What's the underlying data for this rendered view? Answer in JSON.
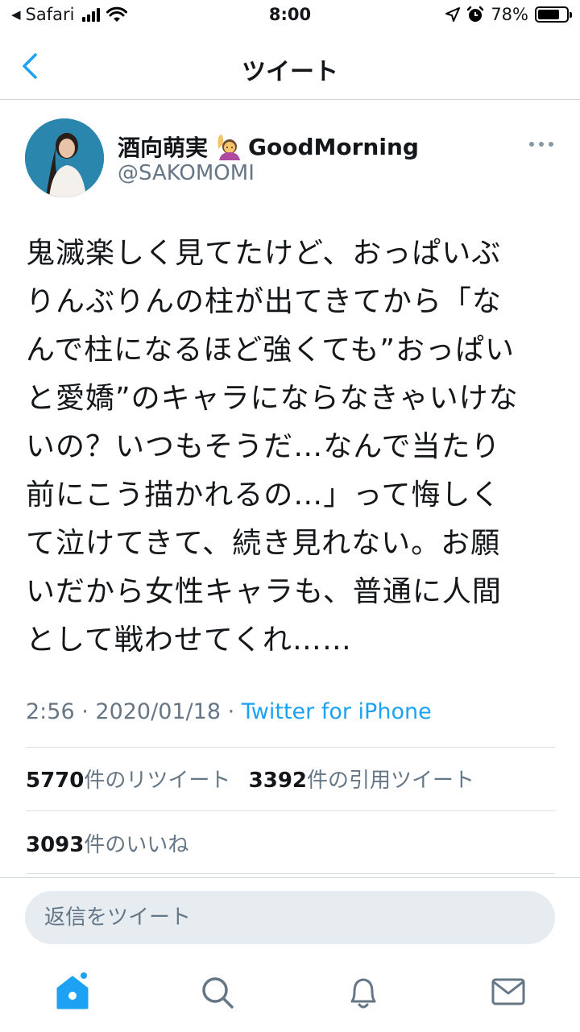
{
  "status_bar": {
    "carrier": "Safari",
    "time": "8:00",
    "battery": "78%",
    "battery_level": 0.78
  },
  "nav": {
    "title": "ツイート"
  },
  "author": {
    "name": "酒向萌実",
    "name_suffix": "GoodMorning",
    "handle": "@SAKOMOMI"
  },
  "tweet": {
    "lines": [
      "鬼滅楽しく見てたけど、おっぱいぶ",
      "りんぶりんの柱が出てきてから「な",
      "んで柱になるほど強くても”おっぱい",
      "と愛嬌”のキャラにならなきゃいけな",
      "いの？いつもそうだ…なんで当たり",
      "前にこう描かれるの…」って悔しく",
      "て泣けてきて、続き見れない。お願",
      "いだから女性キャラも、普通に人間",
      "として戦わせてくれ……"
    ],
    "time": "2:56",
    "date": "2020/01/18",
    "separator": " · ",
    "source": "Twitter for iPhone"
  },
  "stats": {
    "retweets_count": "5770",
    "retweets_label": "件のリツイート",
    "quotes_count": "3392",
    "quotes_label": "件の引用ツイート",
    "likes_count": "3093",
    "likes_label": "件のいいね"
  },
  "reply": {
    "placeholder": "返信をツイート"
  },
  "colors": {
    "accent": "#1da1f2",
    "secondary_text": "#657786",
    "primary_text": "#14171a",
    "reply_bg": "#e6ecf0"
  },
  "icons": [
    "back-chevron-icon",
    "more-icon",
    "home-icon",
    "search-icon",
    "notifications-bell-icon",
    "messages-envelope-icon"
  ]
}
